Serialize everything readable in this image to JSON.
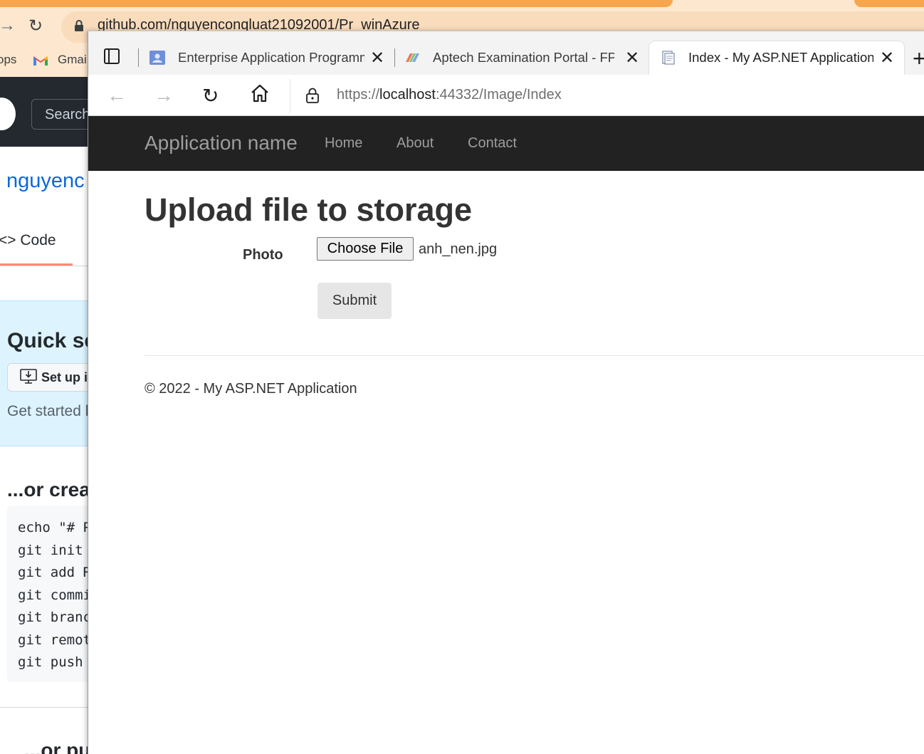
{
  "background_browser": {
    "url": "github.com/nguyenconqluat21092001/Pr_winAzure",
    "bookmarks": [
      "ops",
      "Gmai"
    ],
    "github": {
      "search_placeholder": "Search",
      "owner": "nguyenc",
      "code_tab": "Code",
      "quick_setup_title": "Quick se",
      "setup_button": "Set up i",
      "get_started": "Get started b",
      "create_title": "...or crea",
      "code_lines": [
        "echo \"# P",
        "git init",
        "git add R",
        "git commi",
        "git branc",
        "git remot",
        "git push"
      ],
      "push_title": "...or pus"
    }
  },
  "browser": {
    "tabs": [
      {
        "title": "Enterprise Application Programm",
        "icon": "classroom-icon",
        "active": false
      },
      {
        "title": "Aptech Examination Portal - FPT",
        "icon": "aptech-icon",
        "active": false
      },
      {
        "title": "Index - My ASP.NET Application",
        "icon": "page-icon",
        "active": true
      }
    ],
    "url_scheme": "https://",
    "url_host": "localhost",
    "url_rest": ":44332/Image/Index"
  },
  "site": {
    "brand": "Application name",
    "nav": [
      "Home",
      "About",
      "Contact"
    ],
    "page_title": "Upload file to storage",
    "photo_label": "Photo",
    "choose_file_label": "Choose File",
    "selected_file": "anh_nen.jpg",
    "submit_label": "Submit",
    "footer": "© 2022 - My ASP.NET Application"
  },
  "colors": {
    "chrome_accent": "#f8a64e",
    "navbar_bg": "#222222",
    "link_blue": "#0969da"
  }
}
